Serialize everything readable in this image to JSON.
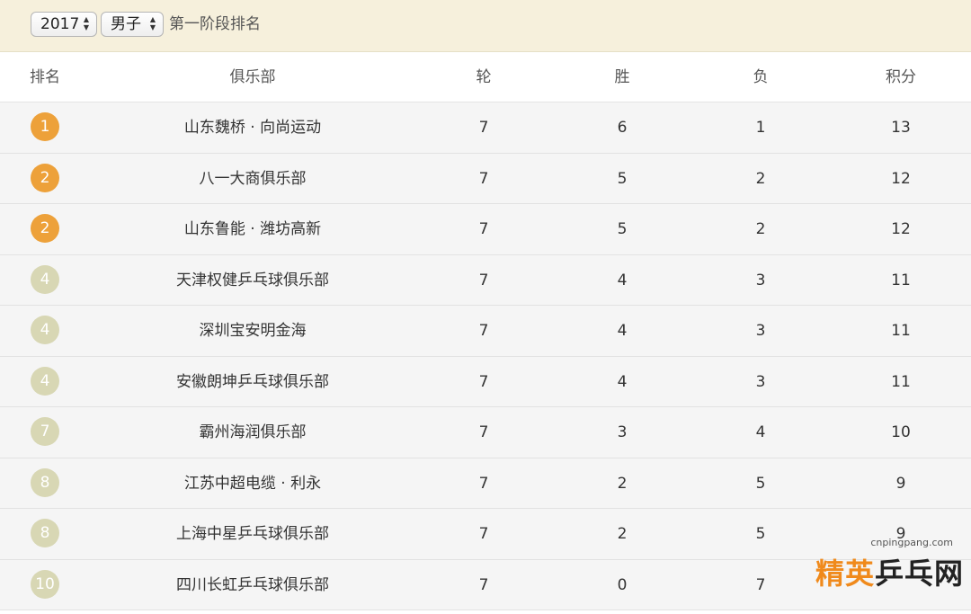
{
  "filters": {
    "year": "2017",
    "gender": "男子",
    "stage": "第一阶段排名"
  },
  "columns": {
    "rank": "排名",
    "club": "俱乐部",
    "rounds": "轮",
    "wins": "胜",
    "losses": "负",
    "points": "积分"
  },
  "rows": [
    {
      "rank": "1",
      "club": "山东魏桥 · 向尚运动",
      "rounds": "7",
      "wins": "6",
      "losses": "1",
      "points": "13",
      "medal": "gold"
    },
    {
      "rank": "2",
      "club": "八一大商俱乐部",
      "rounds": "7",
      "wins": "5",
      "losses": "2",
      "points": "12",
      "medal": "gold"
    },
    {
      "rank": "2",
      "club": "山东鲁能 · 潍坊高新",
      "rounds": "7",
      "wins": "5",
      "losses": "2",
      "points": "12",
      "medal": "gold"
    },
    {
      "rank": "4",
      "club": "天津权健乒乓球俱乐部",
      "rounds": "7",
      "wins": "4",
      "losses": "3",
      "points": "11",
      "medal": "gray"
    },
    {
      "rank": "4",
      "club": "深圳宝安明金海",
      "rounds": "7",
      "wins": "4",
      "losses": "3",
      "points": "11",
      "medal": "gray"
    },
    {
      "rank": "4",
      "club": "安徽朗坤乒乓球俱乐部",
      "rounds": "7",
      "wins": "4",
      "losses": "3",
      "points": "11",
      "medal": "gray"
    },
    {
      "rank": "7",
      "club": "霸州海润俱乐部",
      "rounds": "7",
      "wins": "3",
      "losses": "4",
      "points": "10",
      "medal": "gray"
    },
    {
      "rank": "8",
      "club": "江苏中超电缆 · 利永",
      "rounds": "7",
      "wins": "2",
      "losses": "5",
      "points": "9",
      "medal": "gray"
    },
    {
      "rank": "8",
      "club": "上海中星乒乓球俱乐部",
      "rounds": "7",
      "wins": "2",
      "losses": "5",
      "points": "9",
      "medal": "gray"
    },
    {
      "rank": "10",
      "club": "四川长虹乒乓球俱乐部",
      "rounds": "7",
      "wins": "0",
      "losses": "7",
      "points": "",
      "medal": "gray"
    }
  ],
  "watermark": {
    "url": "cnpingpang.com",
    "logo_accent": "精英",
    "logo_dark": "乒乓网"
  },
  "colors": {
    "gold_badge": "#eda13a",
    "gray_badge": "#d8d7b4",
    "topbar": "#f6f0dc"
  }
}
